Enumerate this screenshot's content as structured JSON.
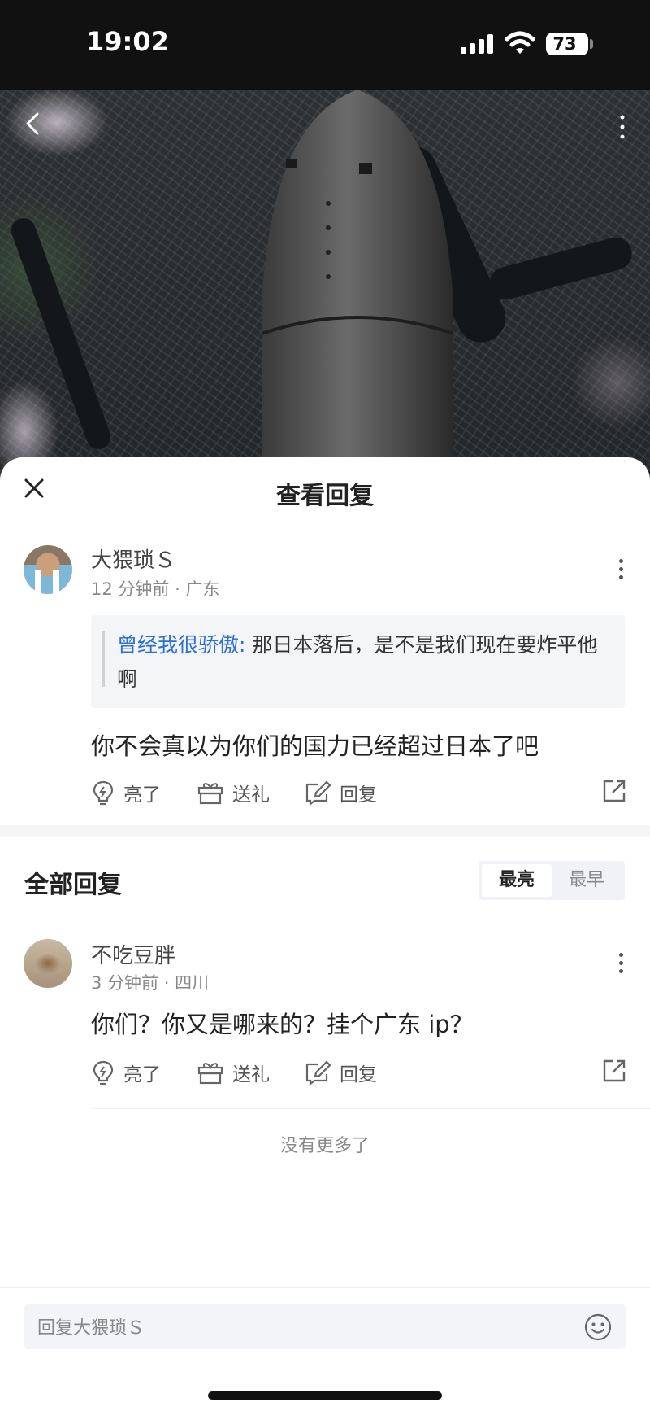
{
  "status_bar": {
    "time": "19:02",
    "battery": "73"
  },
  "sheet": {
    "title": "查看回复"
  },
  "main_comment": {
    "username": "大猥琐Ｓ",
    "time": "12 分钟前",
    "location": "广东",
    "quote_author": "曾经我很骄傲:",
    "quote_text": "那日本落后，是不是我们现在要炸平他啊",
    "text": "你不会真以为你们的国力已经超过日本了吧"
  },
  "actions": {
    "like": "亮了",
    "gift": "送礼",
    "reply": "回复"
  },
  "replies_section": {
    "title": "全部回复",
    "sort_options": [
      "最亮",
      "最早"
    ],
    "active_sort": "最亮"
  },
  "replies": [
    {
      "username": "不吃豆胖",
      "time": "3 分钟前",
      "location": "四川",
      "text": "你们？你又是哪来的？挂个广东 ip？"
    }
  ],
  "footer": {
    "no_more": "没有更多了"
  },
  "reply_input": {
    "placeholder": "回复大猥琐Ｓ"
  },
  "colors": {
    "accent_blue": "#2e6fd6",
    "text_dark": "#222222",
    "text_muted": "#888888"
  }
}
